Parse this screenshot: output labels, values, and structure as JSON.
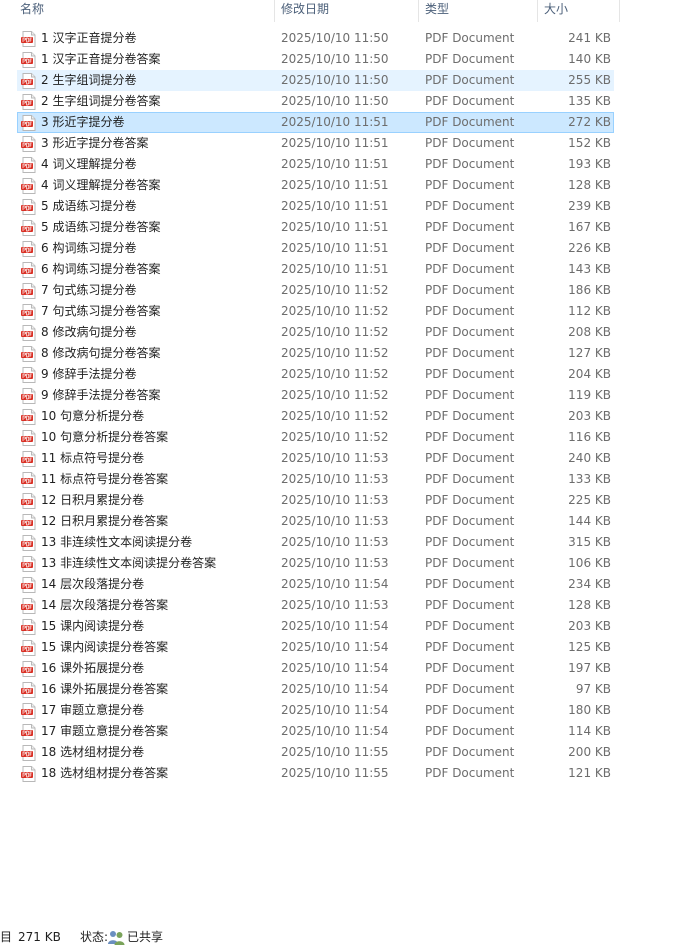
{
  "columns": {
    "name": "名称",
    "date": "修改日期",
    "type": "类型",
    "size": "大小"
  },
  "icon": "pdf-file-icon",
  "colors": {
    "pdf_icon": "#d93025",
    "hover_row": "#e5f3ff",
    "selected_row": "#cce8ff",
    "selected_border": "#99d1ff",
    "header_text": "#4c607a"
  },
  "files": [
    {
      "name": "1 汉字正音提分卷",
      "date": "2025/10/10 11:50",
      "type": "PDF Document",
      "size": "241 KB"
    },
    {
      "name": "1 汉字正音提分卷答案",
      "date": "2025/10/10 11:50",
      "type": "PDF Document",
      "size": "140 KB"
    },
    {
      "name": "2 生字组词提分卷",
      "date": "2025/10/10 11:50",
      "type": "PDF Document",
      "size": "255 KB",
      "state": "hover"
    },
    {
      "name": "2 生字组词提分卷答案",
      "date": "2025/10/10 11:50",
      "type": "PDF Document",
      "size": "135 KB"
    },
    {
      "name": "3 形近字提分卷",
      "date": "2025/10/10 11:51",
      "type": "PDF Document",
      "size": "272 KB",
      "state": "selected"
    },
    {
      "name": "3 形近字提分卷答案",
      "date": "2025/10/10 11:51",
      "type": "PDF Document",
      "size": "152 KB"
    },
    {
      "name": "4 词义理解提分卷",
      "date": "2025/10/10 11:51",
      "type": "PDF Document",
      "size": "193 KB"
    },
    {
      "name": "4 词义理解提分卷答案",
      "date": "2025/10/10 11:51",
      "type": "PDF Document",
      "size": "128 KB"
    },
    {
      "name": "5 成语练习提分卷",
      "date": "2025/10/10 11:51",
      "type": "PDF Document",
      "size": "239 KB"
    },
    {
      "name": "5 成语练习提分卷答案",
      "date": "2025/10/10 11:51",
      "type": "PDF Document",
      "size": "167 KB"
    },
    {
      "name": "6 构词练习提分卷",
      "date": "2025/10/10 11:51",
      "type": "PDF Document",
      "size": "226 KB"
    },
    {
      "name": "6 构词练习提分卷答案",
      "date": "2025/10/10 11:51",
      "type": "PDF Document",
      "size": "143 KB"
    },
    {
      "name": "7 句式练习提分卷",
      "date": "2025/10/10 11:52",
      "type": "PDF Document",
      "size": "186 KB"
    },
    {
      "name": "7 句式练习提分卷答案",
      "date": "2025/10/10 11:52",
      "type": "PDF Document",
      "size": "112 KB"
    },
    {
      "name": "8 修改病句提分卷",
      "date": "2025/10/10 11:52",
      "type": "PDF Document",
      "size": "208 KB"
    },
    {
      "name": "8 修改病句提分卷答案",
      "date": "2025/10/10 11:52",
      "type": "PDF Document",
      "size": "127 KB"
    },
    {
      "name": "9 修辞手法提分卷",
      "date": "2025/10/10 11:52",
      "type": "PDF Document",
      "size": "204 KB"
    },
    {
      "name": "9 修辞手法提分卷答案",
      "date": "2025/10/10 11:52",
      "type": "PDF Document",
      "size": "119 KB"
    },
    {
      "name": "10 句意分析提分卷",
      "date": "2025/10/10 11:52",
      "type": "PDF Document",
      "size": "203 KB"
    },
    {
      "name": "10 句意分析提分卷答案",
      "date": "2025/10/10 11:52",
      "type": "PDF Document",
      "size": "116 KB"
    },
    {
      "name": "11 标点符号提分卷",
      "date": "2025/10/10 11:53",
      "type": "PDF Document",
      "size": "240 KB"
    },
    {
      "name": "11 标点符号提分卷答案",
      "date": "2025/10/10 11:53",
      "type": "PDF Document",
      "size": "133 KB"
    },
    {
      "name": "12 日积月累提分卷",
      "date": "2025/10/10 11:53",
      "type": "PDF Document",
      "size": "225 KB"
    },
    {
      "name": "12 日积月累提分卷答案",
      "date": "2025/10/10 11:53",
      "type": "PDF Document",
      "size": "144 KB"
    },
    {
      "name": "13 非连续性文本阅读提分卷",
      "date": "2025/10/10 11:53",
      "type": "PDF Document",
      "size": "315 KB"
    },
    {
      "name": "13 非连续性文本阅读提分卷答案",
      "date": "2025/10/10 11:53",
      "type": "PDF Document",
      "size": "106 KB"
    },
    {
      "name": "14 层次段落提分卷",
      "date": "2025/10/10 11:54",
      "type": "PDF Document",
      "size": "234 KB"
    },
    {
      "name": "14 层次段落提分卷答案",
      "date": "2025/10/10 11:53",
      "type": "PDF Document",
      "size": "128 KB"
    },
    {
      "name": "15 课内阅读提分卷",
      "date": "2025/10/10 11:54",
      "type": "PDF Document",
      "size": "203 KB"
    },
    {
      "name": "15 课内阅读提分卷答案",
      "date": "2025/10/10 11:54",
      "type": "PDF Document",
      "size": "125 KB"
    },
    {
      "name": "16 课外拓展提分卷",
      "date": "2025/10/10 11:54",
      "type": "PDF Document",
      "size": "197 KB"
    },
    {
      "name": "16 课外拓展提分卷答案",
      "date": "2025/10/10 11:54",
      "type": "PDF Document",
      "size": "97 KB"
    },
    {
      "name": "17 审题立意提分卷",
      "date": "2025/10/10 11:54",
      "type": "PDF Document",
      "size": "180 KB"
    },
    {
      "name": "17 审题立意提分卷答案",
      "date": "2025/10/10 11:54",
      "type": "PDF Document",
      "size": "114 KB"
    },
    {
      "name": "18 选材组材提分卷",
      "date": "2025/10/10 11:55",
      "type": "PDF Document",
      "size": "200 KB"
    },
    {
      "name": "18 选材组材提分卷答案",
      "date": "2025/10/10 11:55",
      "type": "PDF Document",
      "size": "121 KB"
    }
  ],
  "status_bar": {
    "count_suffix": "目",
    "selected_size": "271 KB",
    "state_label": "状态:",
    "state_icon": "shared-users-icon",
    "state_value": "已共享"
  }
}
